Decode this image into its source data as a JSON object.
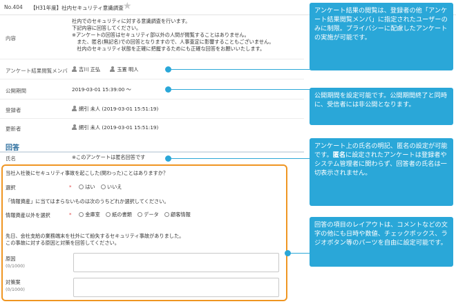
{
  "header": {
    "number": "No.404",
    "title": "【H31年度】社内セキュリティ意識調査"
  },
  "details": {
    "content_label": "内容",
    "content_lines": [
      "社内でのセキュリティに対する意識調査を行います。",
      "下記内容に回答してください。",
      "※アンケートの回答はセキュリティ部以外の人間が閲覧することはありません。",
      "　また、匿名(無記名)での回答となりますので、人事査定に影響することもございません。",
      "　社内のセキュリティ状態を正確に把握するためにも正確な回答をお願いいたします。"
    ],
    "viewers_label": "アンケート結果閲覧メンバ",
    "viewers": [
      "吉川 正弘",
      "玉置 明人"
    ],
    "period_label": "公開期間",
    "period_value": "2019-03-01 15:39:00 ～",
    "registrant_label": "登録者",
    "registrant_value": "網引 未人 (2019-03-01 15:51:19)",
    "updater_label": "更新者",
    "updater_value": "網引 未人 (2019-03-01 15:51:19)"
  },
  "answer": {
    "section_title": "回答",
    "name_label": "氏名",
    "name_value": "※このアンケートは匿名回答です",
    "q1_text": "当社入社後にセキュリティ事故を起こした(関わった)ことはありますか？",
    "q1_label": "選択",
    "q1_required": "*",
    "q1_options": [
      "はい",
      "いいえ"
    ],
    "q2_text": "「情報資産」に当てはまらないものは次のうちどれか選択してください。",
    "q2_label": "情報資産以外を選択",
    "q2_required": "*",
    "q2_options": [
      "金庫室",
      "紙の書類",
      "データ",
      "顧客情報"
    ],
    "q3_lines": [
      "先日、会社支給の業務端末を社外にて紛失するセキュリティ事故がありました。",
      "この事故に対する原因と対策を回答してください。"
    ],
    "cause_label": "原因",
    "cause_counter": "(0/1000)",
    "measure_label": "対策案",
    "measure_counter": "(0/1000)"
  },
  "callouts": {
    "c1": "アンケート結果の閲覧は、登録者の他「アンケート結果閲覧メンバ」に指定されたユーザーのみに制限。プライバシーに配慮したアンケートの実施が可能です。",
    "c2": "公開期間を設定可能です。公開期間終了と同時に、受信者には非公開となります。",
    "c3_normal": "アンケート上の氏名の明記、匿名の設定が可能です。",
    "c3_bold": "匿名",
    "c3_rest": "に設定されたアンケートは登録者やシステム管理者に関わらず、回答者の氏名は一切表示されません。",
    "c4": "回答の項目のレイアウトは、コメントなどの文字の他にも日時や数値、チェックボックス、ラジオボタン等のパーツを自由に設定可能です。"
  },
  "colors": {
    "accent_blue": "#2aa7d8",
    "highlight_orange": "#ef9521",
    "section_blue": "#2b6e9e"
  }
}
